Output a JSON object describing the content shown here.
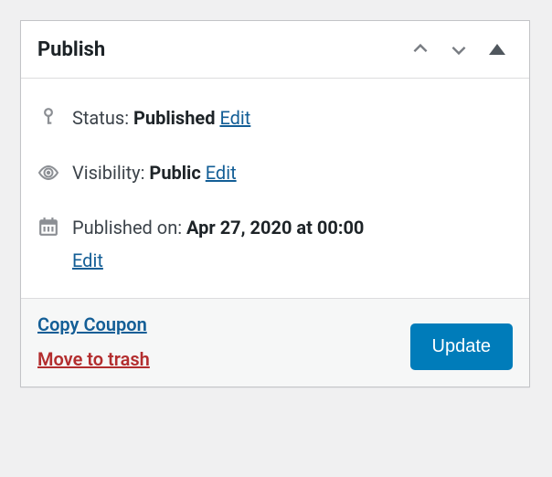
{
  "panel": {
    "title": "Publish"
  },
  "status": {
    "label": "Status:",
    "value": "Published",
    "edit": "Edit"
  },
  "visibility": {
    "label": "Visibility:",
    "value": "Public",
    "edit": "Edit"
  },
  "published": {
    "label": "Published on:",
    "value": "Apr 27, 2020 at 00:00",
    "edit": "Edit"
  },
  "footer": {
    "copy": "Copy Coupon",
    "trash": "Move to trash",
    "update": "Update"
  }
}
